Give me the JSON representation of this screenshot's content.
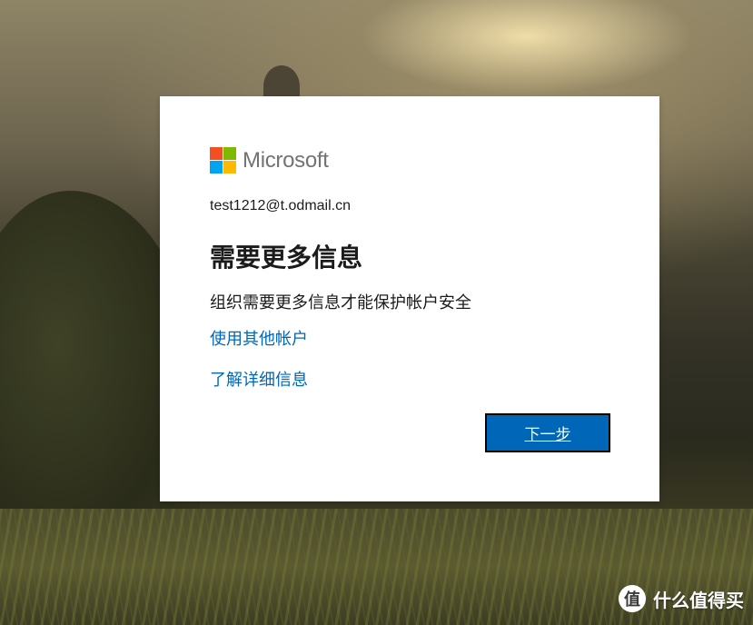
{
  "brand": {
    "name": "Microsoft",
    "logo_colors": [
      "#f25022",
      "#7fba00",
      "#00a4ef",
      "#ffb900"
    ]
  },
  "account": {
    "email": "test1212@t.odmail.cn"
  },
  "dialog": {
    "title": "需要更多信息",
    "description": "组织需要更多信息才能保护帐户安全",
    "links": [
      {
        "label": "使用其他帐户"
      },
      {
        "label": "了解详细信息"
      }
    ],
    "next_button_label": "下一步"
  },
  "watermark": {
    "icon_glyph": "值",
    "text": "什么值得买"
  },
  "colors": {
    "accent": "#0067b8",
    "text": "#1b1b1b",
    "brand_text": "#737373"
  }
}
